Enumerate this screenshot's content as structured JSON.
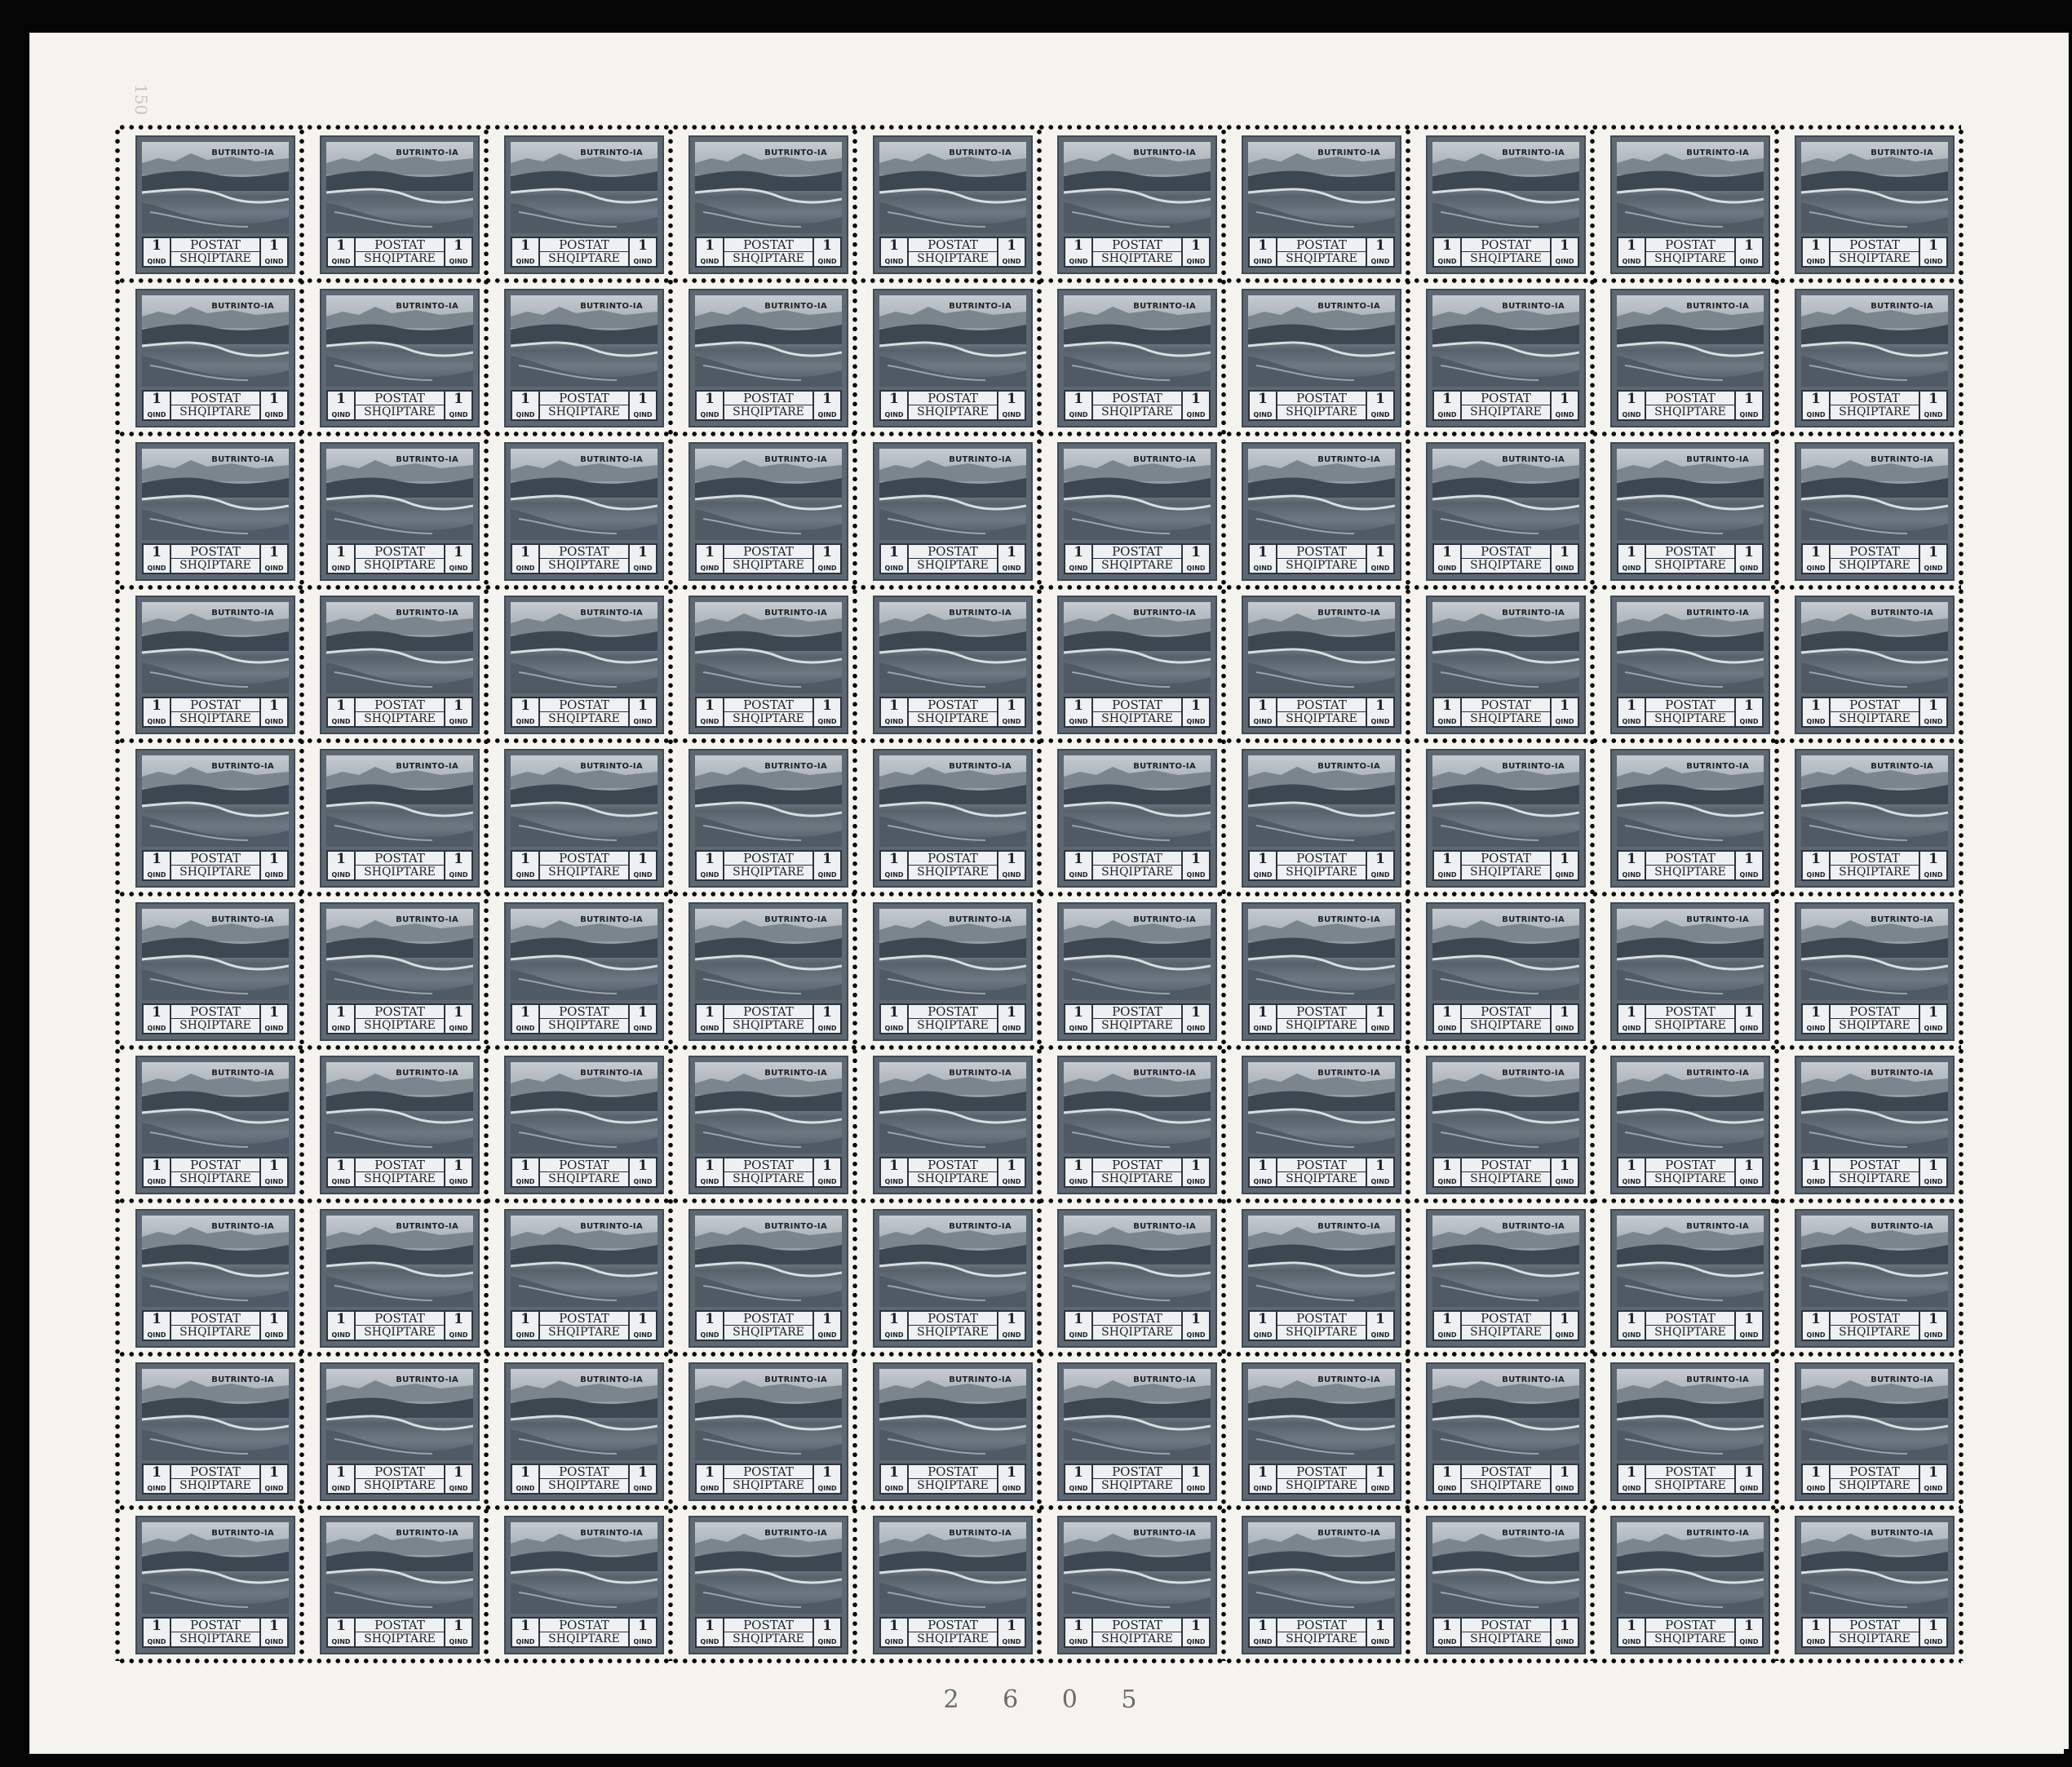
{
  "sheet": {
    "plate_number": "2 6 0 5",
    "margin_mark": "150",
    "rows": 10,
    "columns": 10
  },
  "stamp": {
    "caption": "BUTRINTO-IA",
    "value": "1",
    "unit": "QIND",
    "label_top": "POSTAT",
    "label_bottom": "SHQIPTARE"
  },
  "colors": {
    "stamp_ink": "#5d6873",
    "paper": "#f4f3ee",
    "background": "#050505"
  }
}
